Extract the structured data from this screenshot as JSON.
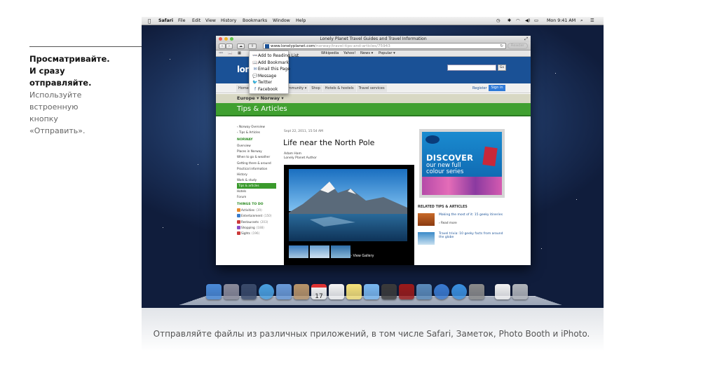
{
  "feature": {
    "heading": [
      "Просматривайте.",
      "И сразу",
      "отправляйте."
    ],
    "description": [
      "Используйте",
      "встроенную",
      "кнопку",
      "«Отправить»."
    ]
  },
  "menubar": {
    "apple": "",
    "items": [
      "Safari",
      "File",
      "Edit",
      "View",
      "History",
      "Bookmarks",
      "Window",
      "Help"
    ],
    "clock": "Mon 9:41 AM"
  },
  "window": {
    "title": "Lonely Planet Travel Guides and Travel Information",
    "url_domain": "www.lonelyplanet.com",
    "url_path": "/norway/travel-tips-and-articles/75943",
    "reader": "Reader",
    "bookmarks": [
      "Wikipedia",
      "Yahoo!",
      "News ▾",
      "Popular ▾"
    ]
  },
  "share_menu": [
    {
      "label": "Add to Reading List",
      "icon": "glasses-icon",
      "glyph": "👓"
    },
    {
      "label": "Add Bookmark",
      "icon": "book-icon",
      "glyph": "📖"
    },
    {
      "label": "Email this Page",
      "icon": "envelope-icon",
      "glyph": "✉"
    },
    {
      "label": "Message",
      "icon": "message-bubble-icon",
      "glyph": "💬"
    },
    {
      "label": "Twitter",
      "icon": "twitter-bird-icon",
      "glyph": "🐦"
    },
    {
      "label": "Facebook",
      "icon": "facebook-icon",
      "glyph": "f"
    }
  ],
  "webpage": {
    "logo": "lonel",
    "go": "Go",
    "nav_tabs": [
      "Home",
      "Destinations ▾",
      "Community ▾",
      "Shop",
      "Hotels & hostels",
      "Travel services"
    ],
    "register": "Register",
    "sign_in": "Sign in",
    "breadcrumbs": "Europe ▾    Norway ▾",
    "section_title": "Tips & Articles",
    "sidebar": {
      "back_links": [
        "‹ Norway Overview",
        "‹ Tips & Articles"
      ],
      "norway_heading": "NORWAY",
      "norway_links": [
        "Overview",
        "Places in Norway",
        "When to go & weather",
        "Getting there & around",
        "Practical information",
        "History",
        "Work & study",
        "Tips & articles",
        "Hotels",
        "Forum"
      ],
      "things_heading": "THINGS TO DO",
      "things": [
        {
          "label": "Activities",
          "count": "(39)",
          "color": "#e8892a"
        },
        {
          "label": "Entertainment",
          "count": "(150)",
          "color": "#3a7ccc"
        },
        {
          "label": "Restaurants",
          "count": "(203)",
          "color": "#cc3a3a"
        },
        {
          "label": "Shopping",
          "count": "(188)",
          "color": "#8a4fc8"
        },
        {
          "label": "Sights",
          "count": "(196)",
          "color": "#cc3a3a"
        }
      ]
    },
    "article": {
      "date": "Sept 22, 2011, 15:54 AM",
      "headline": "Life near the North Pole",
      "author_name": "Adam Ham",
      "author_role": "Lonely Planet Author",
      "view_gallery": "› View Gallery"
    },
    "ad": {
      "line1": "DISCOVER",
      "line2": "our new full",
      "line3": "colour series"
    },
    "related": {
      "heading": "RELATED TIPS & ARTICLES",
      "items": [
        {
          "title": "Making the most of it: 15 geeky itineries",
          "meta": "› Read more"
        },
        {
          "title": "Travel trivia: 10 geeky facts from around the globe",
          "meta": ""
        }
      ]
    }
  },
  "dock": {
    "icons": [
      "finder-icon",
      "launchpad-icon",
      "mission-control-icon",
      "safari-icon",
      "mail-icon",
      "contacts-icon",
      "calendar-icon",
      "reminders-icon",
      "notes-icon",
      "messages-icon",
      "facetime-icon",
      "photo-booth-icon",
      "iphoto-icon",
      "itunes-icon",
      "app-store-icon",
      "system-preferences-icon",
      "document-icon",
      "trash-icon"
    ],
    "calendar_day": "17"
  },
  "caption": "Отправляйте файлы из различных приложений, в том числе Safari, Заметок, Photo Booth и iPhoto."
}
